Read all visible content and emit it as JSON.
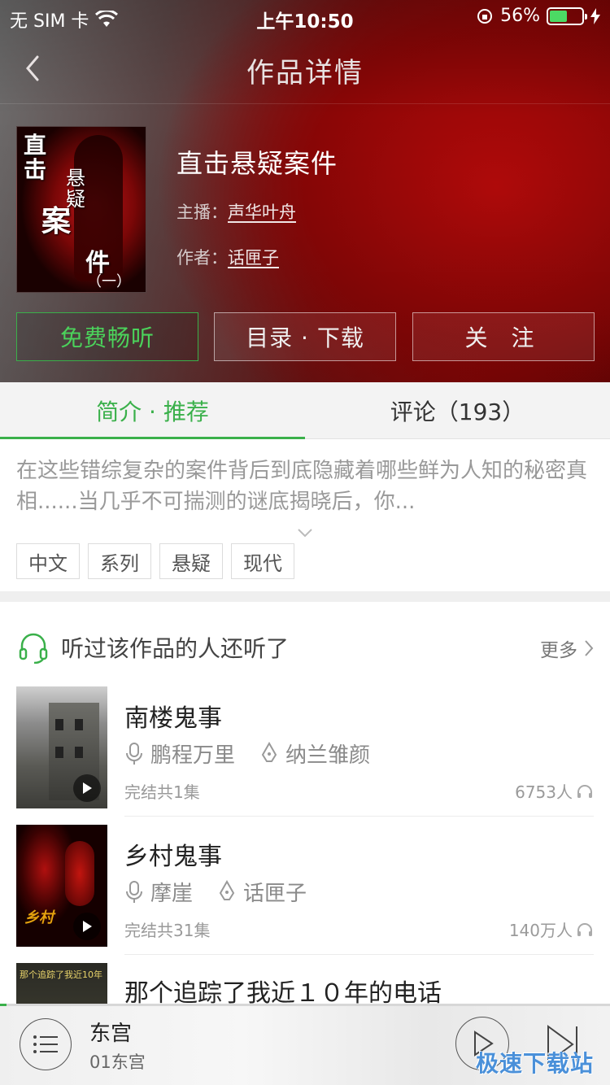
{
  "status_bar": {
    "carrier": "无 SIM 卡",
    "time": "上午10:50",
    "battery": "56%",
    "battery_level": 0.56
  },
  "nav": {
    "title": "作品详情"
  },
  "book": {
    "cover_text": [
      "直",
      "击",
      "悬",
      "疑",
      "案",
      "件",
      "（一）"
    ],
    "title": "直击悬疑案件",
    "host_label": "主播：",
    "host": "声华叶舟",
    "author_label": "作者：",
    "author": "话匣子"
  },
  "actions": {
    "free_listen": "免费畅听",
    "catalog_download": "目录 · 下载",
    "follow": "关 注"
  },
  "tabs": {
    "intro": "简介 · 推荐",
    "comments": "评论（193）"
  },
  "intro": {
    "text": "在这些错综复杂的案件背后到底隐藏着哪些鲜为人知的秘密真相......当几乎不可揣测的谜底揭晓后，你..."
  },
  "tags": [
    "中文",
    "系列",
    "悬疑",
    "现代"
  ],
  "section": {
    "title": "听过该作品的人还听了",
    "more": "更多"
  },
  "items": [
    {
      "title": "南楼鬼事",
      "host": "鹏程万里",
      "author": "纳兰雏颜",
      "episodes": "完结共1集",
      "listeners": "6753人"
    },
    {
      "title": "乡村鬼事",
      "host": "摩崖",
      "author": "话匣子",
      "episodes": "完结共31集",
      "listeners": "140万人"
    },
    {
      "title": "那个追踪了我近１０年的电话"
    }
  ],
  "player": {
    "title": "东宫",
    "subtitle": "01东宫",
    "progress": 0.01
  },
  "watermark": "极速下载站",
  "colors": {
    "accent_green": "#3ab04a",
    "header_red": "#8a0606"
  }
}
